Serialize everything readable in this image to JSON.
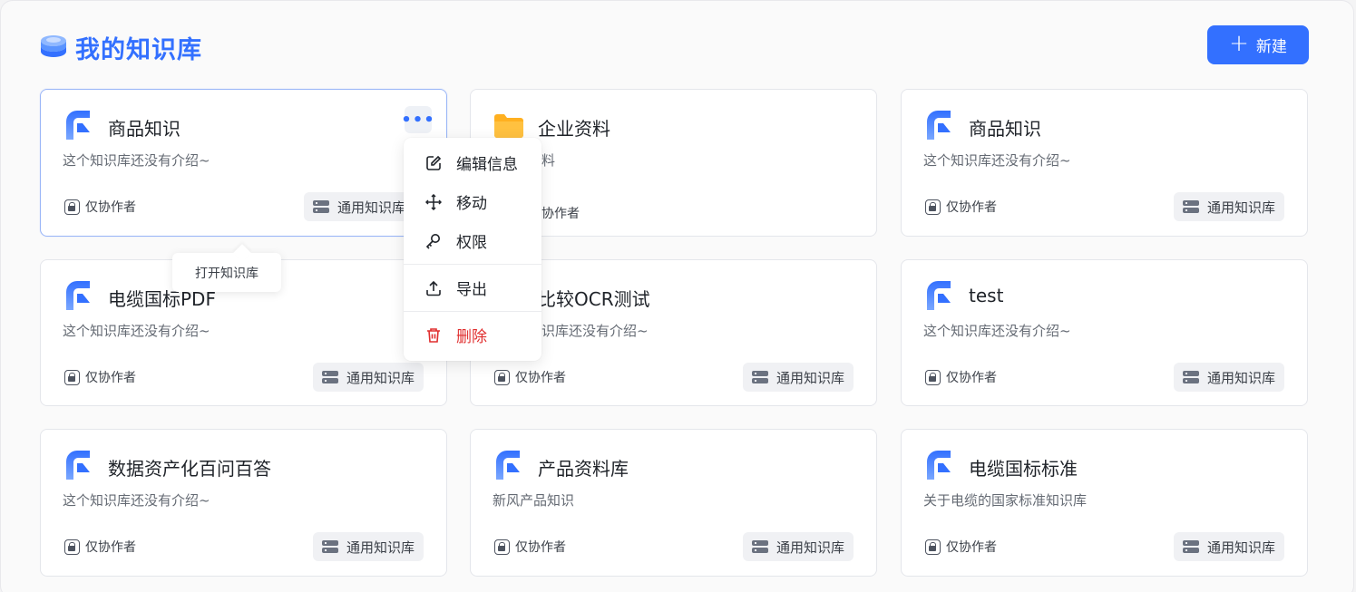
{
  "header": {
    "title": "我的知识库",
    "new_label": "新建"
  },
  "colors": {
    "accent": "#3370ff",
    "danger": "#e02e2e",
    "folder": "#ffb020"
  },
  "cards": [
    {
      "name": "商品知识",
      "desc": "这个知识库还没有介绍~",
      "perm": "仅协作者",
      "type": "通用知识库",
      "icon": "kb-logo-icon"
    },
    {
      "name": "企业资料",
      "desc": "料",
      "perm": "协作者",
      "type": "",
      "icon": "folder-icon"
    },
    {
      "name": "商品知识",
      "desc": "这个知识库还没有介绍~",
      "perm": "仅协作者",
      "type": "通用知识库",
      "icon": "kb-logo-icon"
    },
    {
      "name": "电缆国标PDF",
      "desc": "这个知识库还没有介绍~",
      "perm": "仅协作者",
      "type": "通用知识库",
      "icon": "kb-logo-icon"
    },
    {
      "name": "比较OCR测试",
      "desc": "识库还没有介绍~",
      "perm": "仅协作者",
      "type": "通用知识库",
      "icon": "kb-logo-icon"
    },
    {
      "name": "test",
      "desc": "这个知识库还没有介绍~",
      "perm": "仅协作者",
      "type": "通用知识库",
      "icon": "kb-logo-icon"
    },
    {
      "name": "数据资产化百问百答",
      "desc": "这个知识库还没有介绍~",
      "perm": "仅协作者",
      "type": "通用知识库",
      "icon": "kb-logo-icon"
    },
    {
      "name": "产品资料库",
      "desc": "新风产品知识",
      "perm": "仅协作者",
      "type": "通用知识库",
      "icon": "kb-logo-icon"
    },
    {
      "name": "电缆国标标准",
      "desc": "关于电缆的国家标准知识库",
      "perm": "仅协作者",
      "type": "通用知识库",
      "icon": "kb-logo-icon"
    }
  ],
  "context_menu": {
    "items": [
      {
        "label": "编辑信息",
        "icon": "edit-icon"
      },
      {
        "label": "移动",
        "icon": "move-icon"
      },
      {
        "label": "权限",
        "icon": "key-icon"
      },
      {
        "label": "导出",
        "icon": "upload-icon"
      },
      {
        "label": "删除",
        "icon": "trash-icon"
      }
    ]
  },
  "tooltip": {
    "text": "打开知识库"
  },
  "first_card_type_visible": "通用知识库"
}
